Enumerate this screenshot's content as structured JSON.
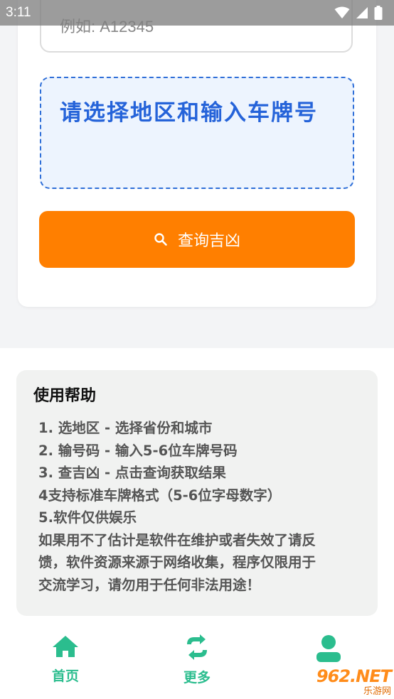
{
  "status_bar": {
    "time": "3:11"
  },
  "plate_input": {
    "placeholder": "例如: A12345"
  },
  "result": {
    "message": "请选择地区和输入车牌号"
  },
  "query_button": {
    "label": "查询吉凶",
    "icon": "search-icon"
  },
  "help": {
    "title": "使用帮助",
    "lines": [
      "1. 选地区 - 选择省份和城市",
      "2. 输号码 - 输入5-6位车牌号码",
      "3. 查吉凶 - 点击查询获取结果",
      "4支持标准车牌格式（5-6位字母数字）",
      "5.软件仅供娱乐",
      "如果用不了估计是软件在维护或者失效了请反",
      "馈，软件资源来源于网络收集，程序仅限用于",
      "交流学习，请勿用于任何非法用途！"
    ]
  },
  "nav": {
    "items": [
      {
        "label": "首页",
        "icon": "home-icon"
      },
      {
        "label": "更多",
        "icon": "swap-icon"
      },
      {
        "label": "",
        "icon": "user-icon"
      }
    ]
  },
  "watermark": {
    "main": "962.NET",
    "sub": "乐游网"
  },
  "colors": {
    "accent_orange": "#ff7f00",
    "result_blue": "#2563d9",
    "nav_green": "#2bbd8e"
  }
}
